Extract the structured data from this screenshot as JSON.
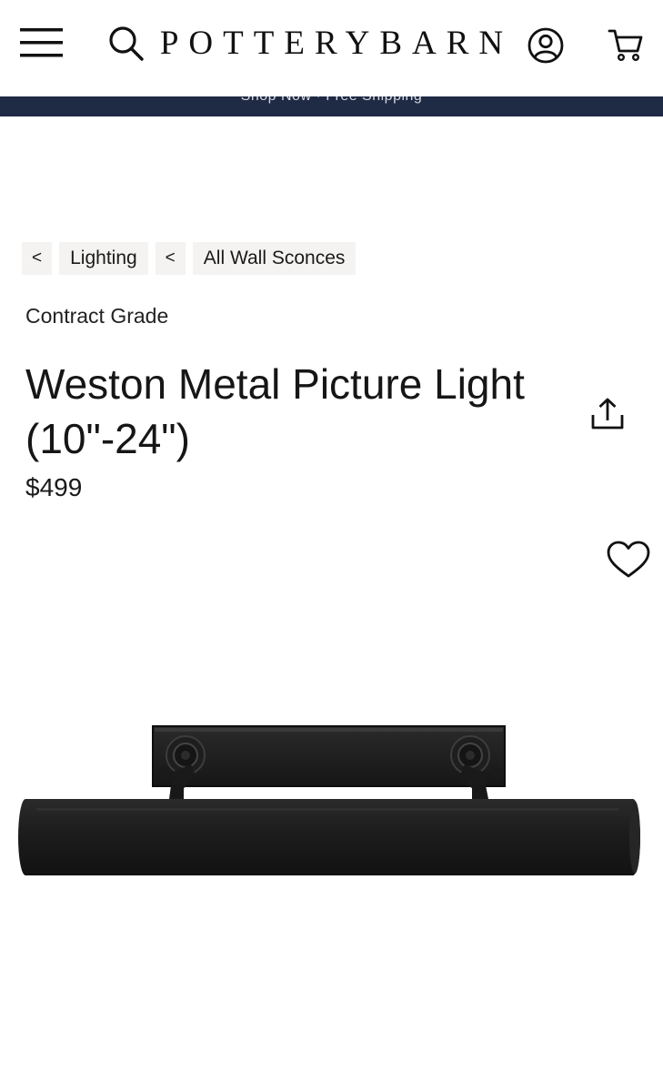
{
  "header": {
    "logo": "POTTERYBARN",
    "icons": {
      "menu": "hamburger-menu-icon",
      "search": "search-icon",
      "account": "account-icon",
      "cart": "cart-icon"
    }
  },
  "promo": {
    "text": "Shop Now · Free Shipping"
  },
  "breadcrumb": {
    "items": [
      {
        "chevron": "<",
        "label": "Lighting"
      },
      {
        "chevron": "<",
        "label": "All Wall Sconces"
      }
    ]
  },
  "product": {
    "eyebrow": "Contract Grade",
    "title": "Weston Metal Picture Light (10\"-24\")",
    "price": "$499",
    "icons": {
      "share": "share-icon",
      "wishlist": "heart-icon"
    },
    "image": "weston-picture-light-bronze"
  },
  "colors": {
    "promo_bar": "#1f2a44",
    "breadcrumb_bg": "#f5f3f1",
    "fixture": "#1c1c1c"
  }
}
